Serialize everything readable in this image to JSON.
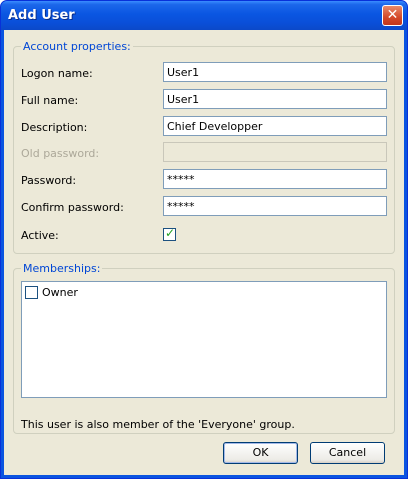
{
  "window": {
    "title": "Add User",
    "close_icon": "close-icon"
  },
  "account": {
    "legend": "Account properties:",
    "fields": [
      {
        "label": "Logon name:",
        "value": "User1",
        "disabled": false
      },
      {
        "label": "Full name:",
        "value": "User1",
        "disabled": false
      },
      {
        "label": "Description:",
        "value": "Chief Developper",
        "disabled": false
      },
      {
        "label": "Old password:",
        "value": "",
        "disabled": true
      },
      {
        "label": "Password:",
        "value": "*****",
        "disabled": false
      },
      {
        "label": "Confirm password:",
        "value": "*****",
        "disabled": false
      }
    ],
    "active": {
      "label": "Active:",
      "checked": true
    }
  },
  "memberships": {
    "legend": "Memberships:",
    "items": [
      {
        "label": "Owner",
        "checked": false
      }
    ],
    "note": "This user is also member of the 'Everyone' group."
  },
  "buttons": {
    "ok": "OK",
    "cancel": "Cancel"
  },
  "colors": {
    "title_bar": "#0a54e0",
    "dialog_bg": "#ece9d8",
    "legend": "#0046d5",
    "check": "#21a121"
  }
}
